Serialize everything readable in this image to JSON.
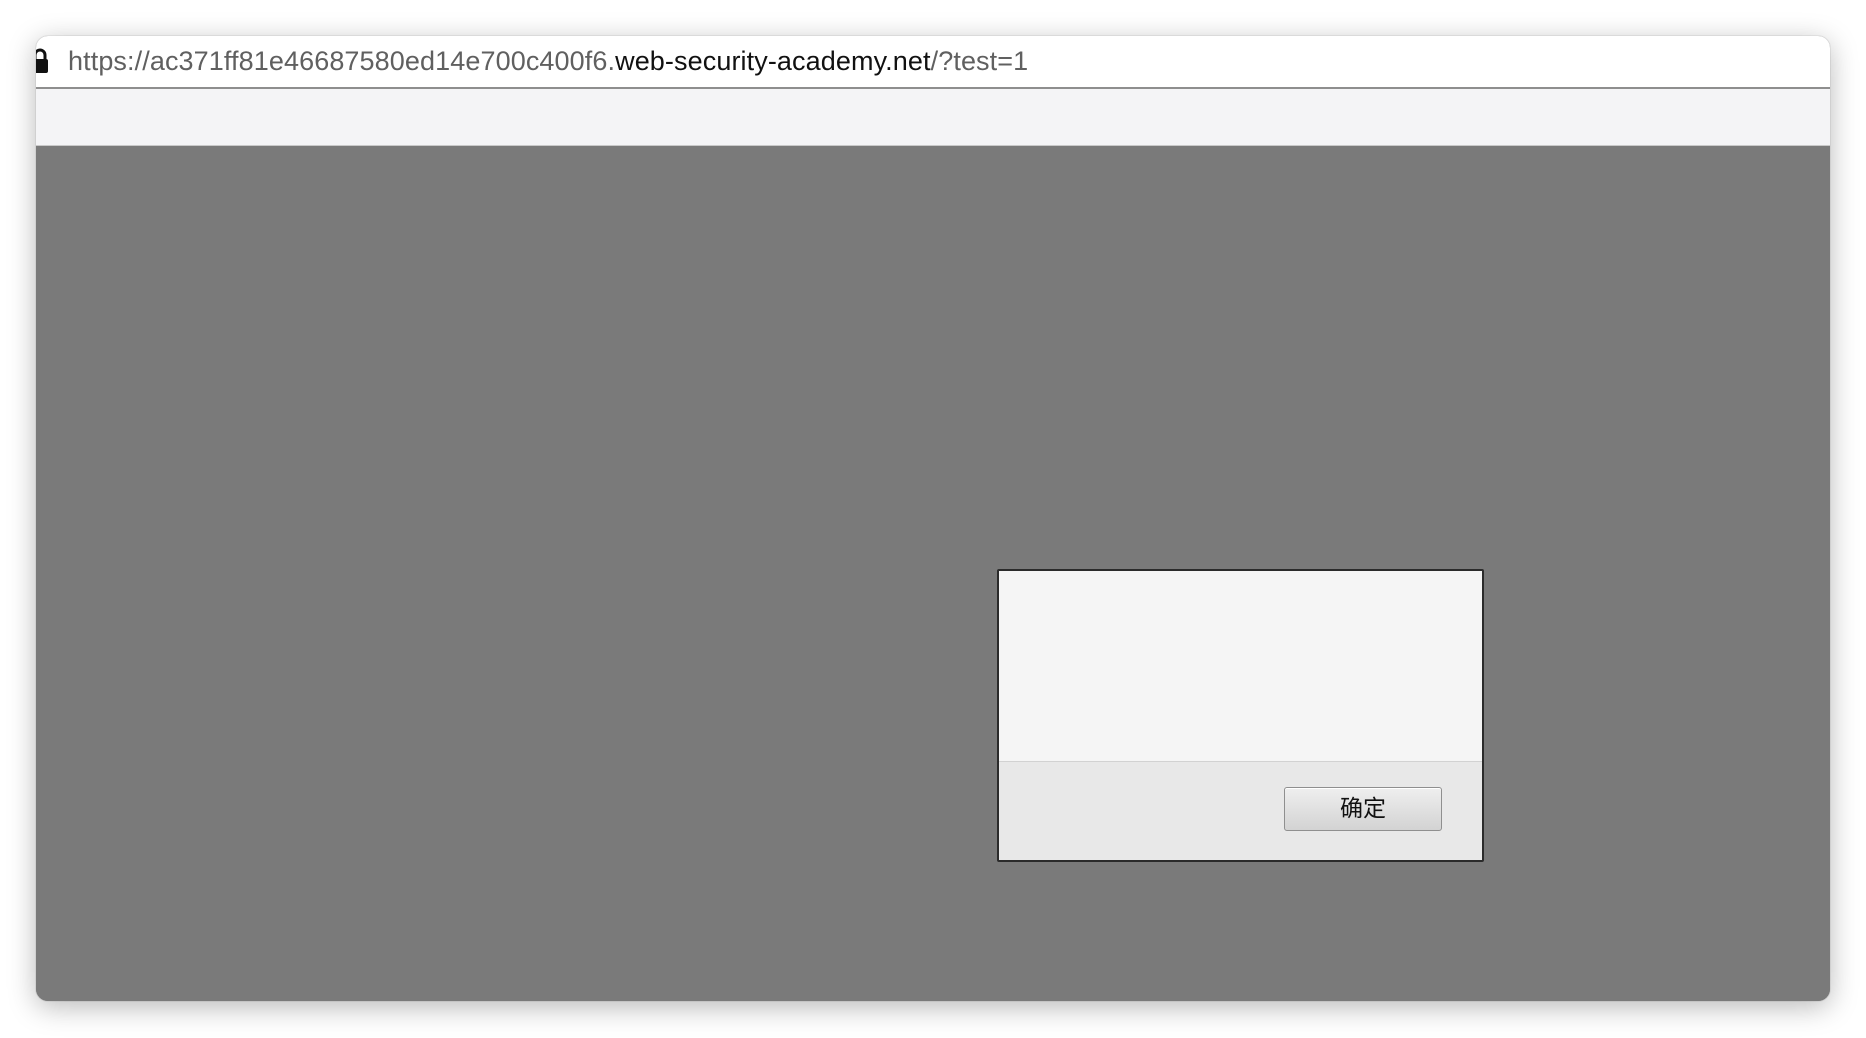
{
  "browser": {
    "url": {
      "prefix": "https://ac371ff81e46687580ed14e700c400f6.",
      "domain": "web-security-academy.net",
      "suffix": "/?test=1"
    },
    "icons": {
      "security": "lock-icon"
    }
  },
  "dialog": {
    "message": "",
    "ok_label": "确定"
  },
  "colors": {
    "overlay": "#7a7a7a",
    "dialog_background": "#f5f5f5",
    "dialog_footer": "#e8e8e8"
  }
}
